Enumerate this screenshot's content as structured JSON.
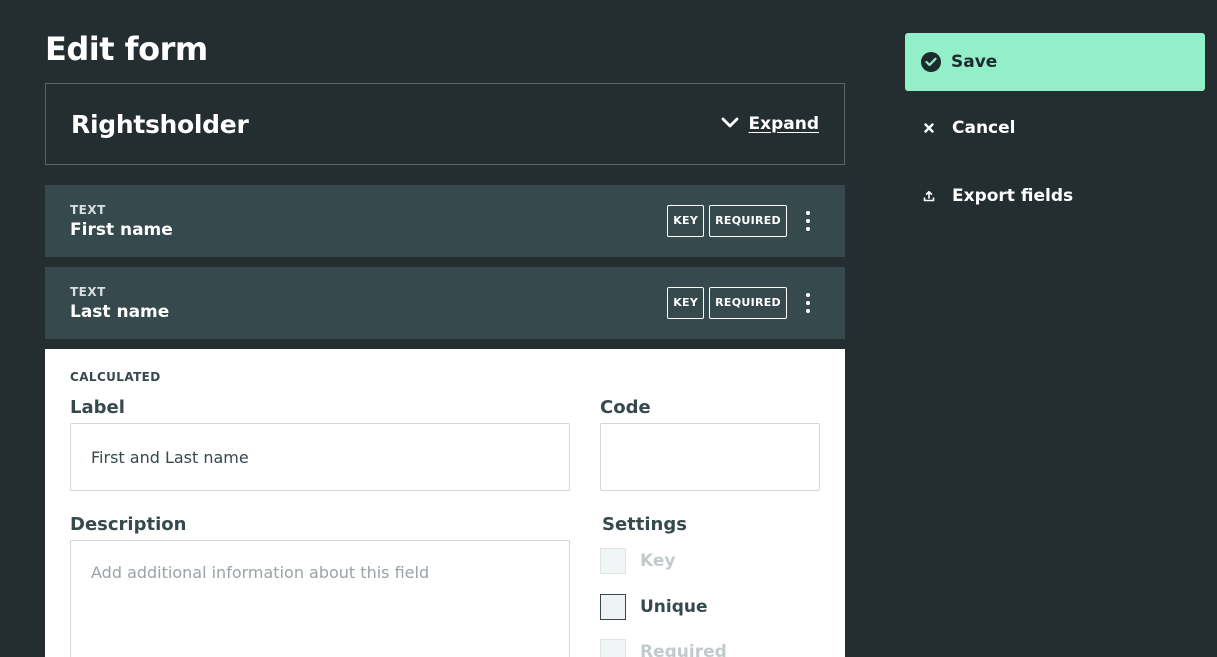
{
  "page": {
    "title": "Edit form"
  },
  "section": {
    "title": "Rightsholder",
    "expand_label": "Expand"
  },
  "fields": [
    {
      "type": "TEXT",
      "name": "First name",
      "tags": [
        "KEY",
        "REQUIRED"
      ]
    },
    {
      "type": "TEXT",
      "name": "Last name",
      "tags": [
        "KEY",
        "REQUIRED"
      ]
    }
  ],
  "editor": {
    "type": "CALCULATED",
    "label_title": "Label",
    "label_value": "First and Last name",
    "code_title": "Code",
    "code_value": "",
    "description_title": "Description",
    "description_placeholder": "Add additional information about this field",
    "settings_title": "Settings",
    "settings": [
      {
        "label": "Key",
        "checked": false,
        "disabled": true
      },
      {
        "label": "Unique",
        "checked": false,
        "disabled": false
      },
      {
        "label": "Required",
        "checked": false,
        "disabled": true
      }
    ]
  },
  "actions": {
    "save_label": "Save",
    "cancel_label": "Cancel",
    "export_label": "Export fields"
  },
  "colors": {
    "background": "#242e30",
    "row": "#36494c",
    "accent": "#92efc9"
  },
  "icons": {
    "save": "check-circle-icon",
    "cancel": "x-icon",
    "export": "upload-icon",
    "expand": "chevron-down-icon",
    "row_menu": "kebab-menu-icon"
  }
}
